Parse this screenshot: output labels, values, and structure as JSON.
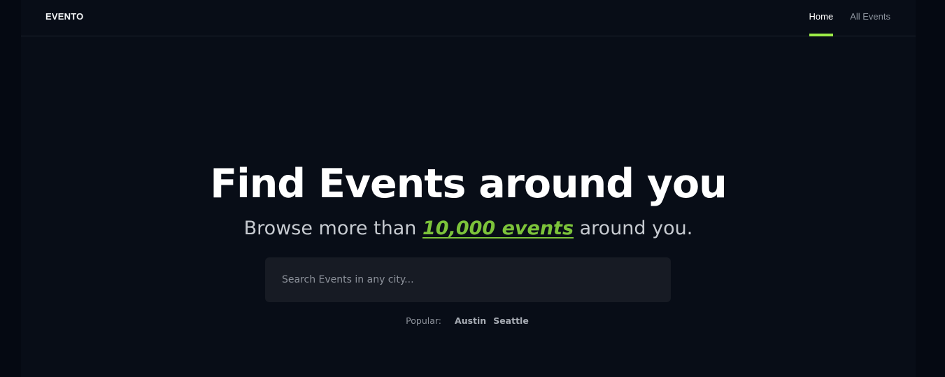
{
  "header": {
    "logo": "EVENTO",
    "nav": [
      {
        "label": "Home",
        "active": true
      },
      {
        "label": "All Events",
        "active": false
      }
    ]
  },
  "hero": {
    "title": "Find Events around you",
    "subtitle_before": "Browse more than",
    "subtitle_highlight": "10,000 events",
    "subtitle_after": "around you."
  },
  "search": {
    "placeholder": "Search Events in any city...",
    "value": ""
  },
  "popular": {
    "label": "Popular:",
    "cities": [
      "Austin",
      "Seattle"
    ]
  },
  "colors": {
    "accent": "#9ded47",
    "highlight_text": "#7cc33a",
    "background": "#080d17"
  }
}
